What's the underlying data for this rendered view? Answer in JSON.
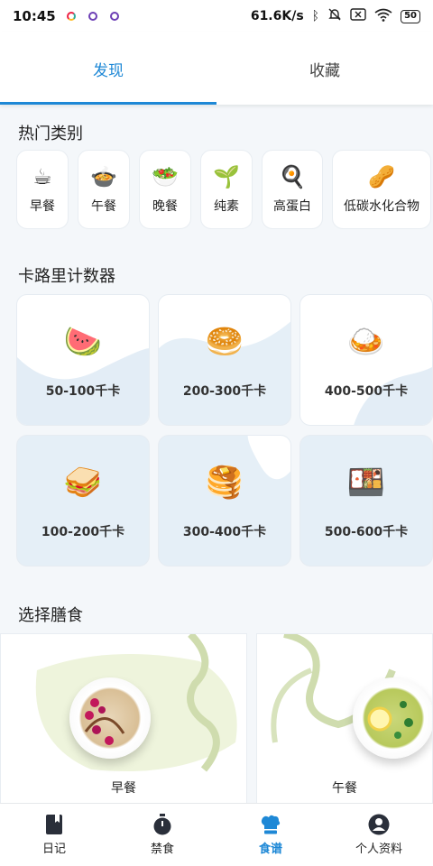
{
  "status_bar": {
    "time": "10:45",
    "network_speed": "61.6K/s",
    "battery": "50"
  },
  "tabs": [
    {
      "label": "发现",
      "active": true
    },
    {
      "label": "收藏",
      "active": false
    }
  ],
  "hot_categories": {
    "title": "热门类别",
    "items": [
      {
        "emoji": "☕",
        "label": "早餐"
      },
      {
        "emoji": "🍲",
        "label": "午餐"
      },
      {
        "emoji": "🥗",
        "label": "晚餐"
      },
      {
        "emoji": "🌱",
        "label": "纯素"
      },
      {
        "emoji": "🍳",
        "label": "高蛋白"
      },
      {
        "emoji": "🥜",
        "label": "低碳水化合物"
      }
    ]
  },
  "calorie_counter": {
    "title": "卡路里计数器",
    "cards": [
      {
        "emoji": "🍉",
        "label": "50-100千卡"
      },
      {
        "emoji": "🥯",
        "label": "200-300千卡"
      },
      {
        "emoji": "🍛",
        "label": "400-500千卡"
      },
      {
        "emoji": "🥪",
        "label": "100-200千卡"
      },
      {
        "emoji": "🥞",
        "label": "300-400千卡"
      },
      {
        "emoji": "🍱",
        "label": "500-600千卡"
      }
    ]
  },
  "meal_select": {
    "title": "选择膳食",
    "items": [
      {
        "label": "早餐"
      },
      {
        "label": "午餐"
      }
    ]
  },
  "bottom_nav": [
    {
      "label": "日记",
      "icon": "diary-icon",
      "active": false
    },
    {
      "label": "禁食",
      "icon": "timer-icon",
      "active": false
    },
    {
      "label": "食谱",
      "icon": "chef-hat-icon",
      "active": true
    },
    {
      "label": "个人资料",
      "icon": "profile-icon",
      "active": false
    }
  ],
  "colors": {
    "accent": "#1e88d6",
    "card_blue": "#e5eff7",
    "wave": "#dde9f3"
  }
}
